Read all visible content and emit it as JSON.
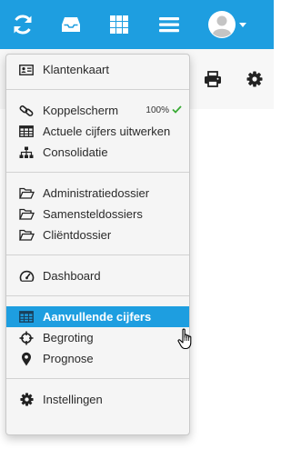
{
  "topbar": {
    "icons": [
      "refresh-icon",
      "inbox-icon",
      "grid-icon",
      "menu-icon",
      "user-avatar-icon",
      "caret-down-icon"
    ]
  },
  "subbar": {
    "icons": [
      "print-icon",
      "gear-icon"
    ]
  },
  "menu": {
    "klantenkaart": "Klantenkaart",
    "koppelscherm": "Koppelscherm",
    "koppelscherm_progress": "100%",
    "actuele_cijfers": "Actuele cijfers uitwerken",
    "consolidatie": "Consolidatie",
    "administratiedossier": "Administratiedossier",
    "samensteldossiers": "Samensteldossiers",
    "clientdossier": "Cliëntdossier",
    "dashboard": "Dashboard",
    "aanvullende_cijfers": "Aanvullende cijfers",
    "begroting": "Begroting",
    "prognose": "Prognose",
    "instellingen": "Instellingen"
  },
  "colors": {
    "brand": "#1e9ee0",
    "check": "#3aaa35"
  }
}
